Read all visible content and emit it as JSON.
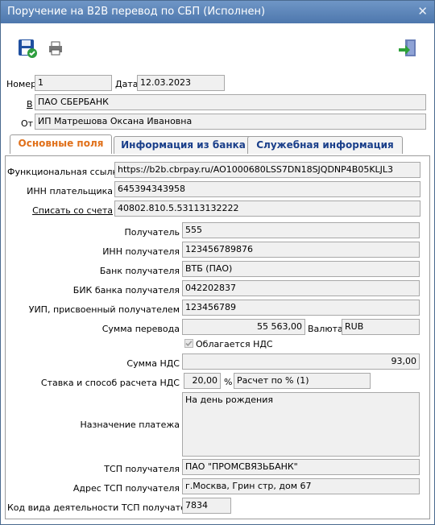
{
  "window": {
    "title": "Поручение на B2B перевод по СБП (Исполнен)"
  },
  "header": {
    "number_label": "Номер",
    "number_value": "1",
    "date_label": "Дата",
    "date_value": "12.03.2023",
    "to_label": "В",
    "to_value": "ПАО СБЕРБАНК",
    "from_label": "От",
    "from_value": "ИП Матрешова Оксана Ивановна"
  },
  "tabs": [
    "Основные поля",
    "Информация из банка",
    "Служебная информация"
  ],
  "form": {
    "func_link_label": "Функциональная ссылка",
    "func_link_value": "https://b2b.cbrpay.ru/AO1000680LSS7DN18SJQDNP4B05KLJL3",
    "payer_inn_label": "ИНН плательщика",
    "payer_inn_value": "645394343958",
    "debit_account_label": "Списать со счета",
    "debit_account_value": "40802.810.5.53113132222",
    "recipient_label": "Получатель",
    "recipient_value": "555",
    "recipient_inn_label": "ИНН получателя",
    "recipient_inn_value": "123456789876",
    "recipient_bank_label": "Банк получателя",
    "recipient_bank_value": "ВТБ (ПАО)",
    "recipient_bik_label": "БИК банка получателя",
    "recipient_bik_value": "042202837",
    "uip_label": "УИП, присвоенный получателем",
    "uip_value": "123456789",
    "amount_label": "Сумма перевода",
    "amount_value": "55 563,00",
    "currency_label": "Валюта",
    "currency_value": "RUB",
    "vat_checkbox_label": "Облагается НДС",
    "vat_amount_label": "Сумма НДС",
    "vat_amount_value": "93,00",
    "vat_rate_label": "Ставка и способ расчета НДС",
    "vat_rate_value": "20,00",
    "percent_sign": "%",
    "vat_method_value": "Расчет по % (1)",
    "purpose_label": "Назначение платежа",
    "purpose_value": "На день рождения",
    "tsp_label": "ТСП получателя",
    "tsp_value": "ПАО \"ПРОМСВЯЗЬБАНК\"",
    "tsp_address_label": "Адрес ТСП получателя",
    "tsp_address_value": "г.Москва, Грин стр, дом 67",
    "tsp_activity_label": "Код вида деятельности ТСП получателя",
    "tsp_activity_value": "7834"
  },
  "icons": {
    "save": "save-icon",
    "print": "printer-icon",
    "exit": "exit-icon"
  },
  "colors": {
    "titlebar": "#4d77ad",
    "active_tab": "#e0701a",
    "tab_text": "#1a3f8a"
  }
}
